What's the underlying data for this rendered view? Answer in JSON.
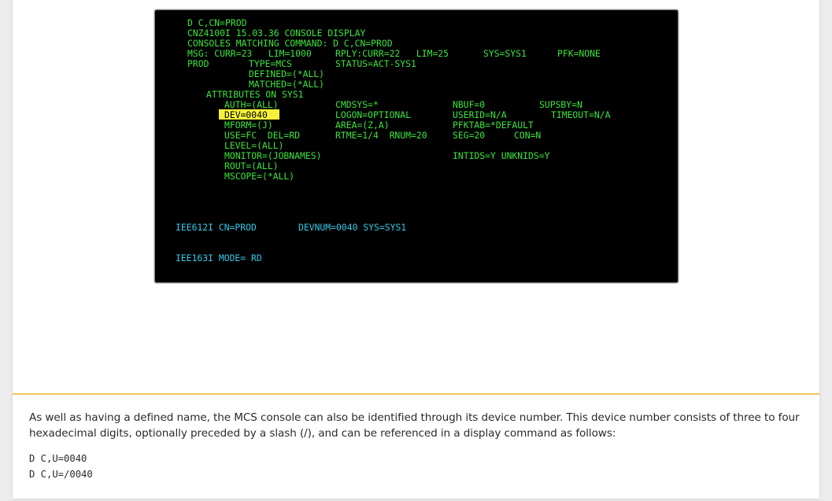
{
  "terminal": {
    "lines": {
      "l1": "D C,CN=PROD",
      "l2": "CNZ4100I 15.03.36 CONSOLE DISPLAY",
      "l3": "CONSOLES MATCHING COMMAND: D C,CN=PROD",
      "l4_msg": "MSG: CURR=23   LIM=1000",
      "l4_rply": "RPLY:CURR=22   LIM=25",
      "l4_sys": "SYS=SYS1",
      "l4_pfk": "PFK=NONE",
      "l5_prod": "PROD",
      "l5_type": "TYPE=MCS",
      "l5_status": "STATUS=ACT-SYS1",
      "l6": "DEFINED=(*ALL)",
      "l7": "MATCHED=(*ALL)",
      "l8": "ATTRIBUTES ON SYS1",
      "a_auth": "AUTH=(ALL)",
      "a_cmdsys": "CMDSYS=*",
      "a_nbuf": "NBUF=0",
      "a_supsby": "SUPSBY=N",
      "a_dev": "DEV=0040",
      "a_logon": "LOGON=OPTIONAL",
      "a_userid": "USERID=N/A",
      "a_timeout": "TIMEOUT=N/A",
      "a_mform": "MFORM=(J)",
      "a_area": "AREA=(Z,A)",
      "a_pfktab": "PFKTAB=*DEFAULT",
      "a_use": "USE=FC  DEL=RD",
      "a_rtme": "RTME=1/4  RNUM=20",
      "a_seg": "SEG=20",
      "a_con": "CON=N",
      "a_level": "LEVEL=(ALL)",
      "a_monitor": "MONITOR=(JOBNAMES)",
      "a_intids": "INTIDS=Y UNKNIDS=Y",
      "a_rout": "ROUT=(ALL)",
      "a_mscope": "MSCOPE=(*ALL)",
      "iee612i_id": "IEE612I CN=PROD",
      "iee612i_dev": "DEVNUM=0040 SYS=SYS1",
      "iee163i": "IEE163I MODE= RD"
    },
    "colors": {
      "green": "#3ce43c",
      "cyan": "#36c8e8",
      "highlight": "#f5f03a"
    }
  },
  "article": {
    "paragraph": "As well as having a defined name, the MCS console can also be identified through its device number. This device number consists of three to four hexadecimal digits, optionally preceded by a slash (/), and can be referenced in a display command as follows:",
    "code1": "D C,U=0040",
    "code2": "D C,U=/0040"
  },
  "divider_color": "#f0c552"
}
